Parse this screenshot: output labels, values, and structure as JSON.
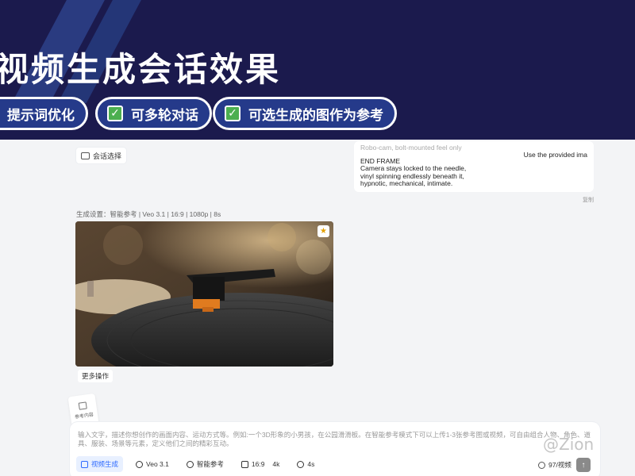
{
  "banner": {
    "title": "视频生成会话效果",
    "features": [
      "提示词优化",
      "可多轮对话",
      "可选生成的图作为参考"
    ],
    "bg_color": "#1b1a4d",
    "pill_color": "#253a8a"
  },
  "session_selector": {
    "label": "会话选择",
    "icon": "chat-icon"
  },
  "prompt_card": {
    "faded_line": "Robo-cam, bolt-mounted feel only",
    "heading": "END FRAME",
    "lines": [
      "Camera stays locked to the needle,",
      "vinyl spinning endlessly beneath it,",
      "hypnotic, mechanical, intimate."
    ],
    "use_button": "Use the provided ima",
    "copy_label": "复制"
  },
  "generation": {
    "settings_text": "生成设置：智能参考 | Veo 3.1 | 16:9 | 1080p | 8s",
    "more_actions": "更多操作",
    "video_icon": "star-icon"
  },
  "reference_tile": {
    "label": "参考内容"
  },
  "composer": {
    "placeholder": "输入文字，描述你想创作的画面内容、运动方式等。例如:一个3D形象的小男孩，在公园滑滑板。在智能参考模式下可以上传1-3张参考图或视频，可自由组合人物、角色、道具、服装、场景等元素，定义他们之间的精彩互动。",
    "toolbar": {
      "mode": "视频生成",
      "model": "Veo 3.1",
      "reference": "智能参考",
      "ratio": "16:9",
      "resolution": "4k",
      "duration": "4s"
    },
    "count": "97/视频",
    "accent": "#2f6bff"
  },
  "watermark": "@Zion"
}
